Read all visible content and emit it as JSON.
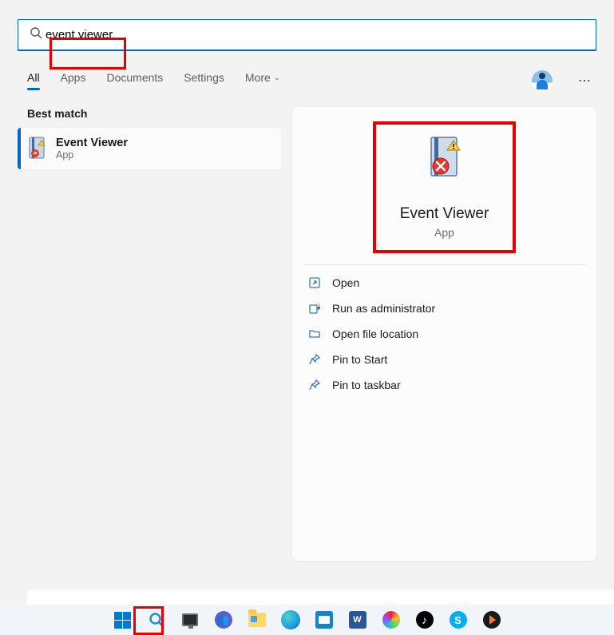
{
  "search": {
    "value": "event viewer"
  },
  "tabs": [
    "All",
    "Apps",
    "Documents",
    "Settings",
    "More"
  ],
  "section_header": "Best match",
  "result": {
    "title": "Event Viewer",
    "subtitle": "App"
  },
  "preview": {
    "title": "Event Viewer",
    "subtitle": "App"
  },
  "actions": [
    {
      "icon": "open",
      "label": "Open"
    },
    {
      "icon": "admin",
      "label": "Run as administrator"
    },
    {
      "icon": "folder",
      "label": "Open file location"
    },
    {
      "icon": "pin",
      "label": "Pin to Start"
    },
    {
      "icon": "pin",
      "label": "Pin to taskbar"
    }
  ],
  "word_letter": "W",
  "tiktok_letter": "♪",
  "skype_letter": "S",
  "teams_letter": "👥"
}
